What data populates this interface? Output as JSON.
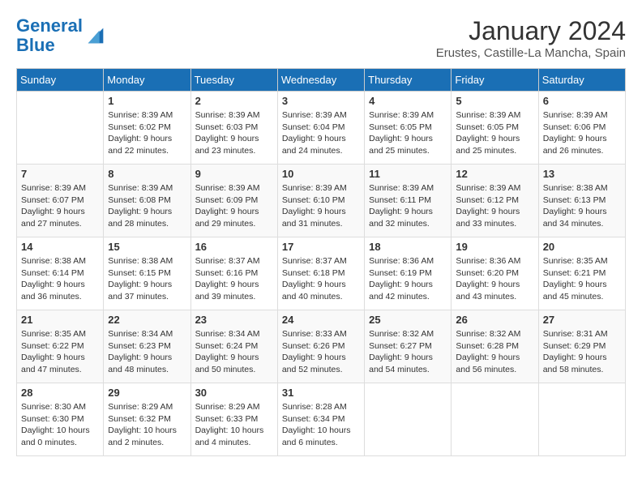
{
  "header": {
    "logo_line1": "General",
    "logo_line2": "Blue",
    "month": "January 2024",
    "location": "Erustes, Castille-La Mancha, Spain"
  },
  "days_of_week": [
    "Sunday",
    "Monday",
    "Tuesday",
    "Wednesday",
    "Thursday",
    "Friday",
    "Saturday"
  ],
  "weeks": [
    [
      {
        "day": "",
        "sunrise": "",
        "sunset": "",
        "daylight": ""
      },
      {
        "day": "1",
        "sunrise": "Sunrise: 8:39 AM",
        "sunset": "Sunset: 6:02 PM",
        "daylight": "Daylight: 9 hours and 22 minutes."
      },
      {
        "day": "2",
        "sunrise": "Sunrise: 8:39 AM",
        "sunset": "Sunset: 6:03 PM",
        "daylight": "Daylight: 9 hours and 23 minutes."
      },
      {
        "day": "3",
        "sunrise": "Sunrise: 8:39 AM",
        "sunset": "Sunset: 6:04 PM",
        "daylight": "Daylight: 9 hours and 24 minutes."
      },
      {
        "day": "4",
        "sunrise": "Sunrise: 8:39 AM",
        "sunset": "Sunset: 6:05 PM",
        "daylight": "Daylight: 9 hours and 25 minutes."
      },
      {
        "day": "5",
        "sunrise": "Sunrise: 8:39 AM",
        "sunset": "Sunset: 6:05 PM",
        "daylight": "Daylight: 9 hours and 25 minutes."
      },
      {
        "day": "6",
        "sunrise": "Sunrise: 8:39 AM",
        "sunset": "Sunset: 6:06 PM",
        "daylight": "Daylight: 9 hours and 26 minutes."
      }
    ],
    [
      {
        "day": "7",
        "sunrise": "Sunrise: 8:39 AM",
        "sunset": "Sunset: 6:07 PM",
        "daylight": "Daylight: 9 hours and 27 minutes."
      },
      {
        "day": "8",
        "sunrise": "Sunrise: 8:39 AM",
        "sunset": "Sunset: 6:08 PM",
        "daylight": "Daylight: 9 hours and 28 minutes."
      },
      {
        "day": "9",
        "sunrise": "Sunrise: 8:39 AM",
        "sunset": "Sunset: 6:09 PM",
        "daylight": "Daylight: 9 hours and 29 minutes."
      },
      {
        "day": "10",
        "sunrise": "Sunrise: 8:39 AM",
        "sunset": "Sunset: 6:10 PM",
        "daylight": "Daylight: 9 hours and 31 minutes."
      },
      {
        "day": "11",
        "sunrise": "Sunrise: 8:39 AM",
        "sunset": "Sunset: 6:11 PM",
        "daylight": "Daylight: 9 hours and 32 minutes."
      },
      {
        "day": "12",
        "sunrise": "Sunrise: 8:39 AM",
        "sunset": "Sunset: 6:12 PM",
        "daylight": "Daylight: 9 hours and 33 minutes."
      },
      {
        "day": "13",
        "sunrise": "Sunrise: 8:38 AM",
        "sunset": "Sunset: 6:13 PM",
        "daylight": "Daylight: 9 hours and 34 minutes."
      }
    ],
    [
      {
        "day": "14",
        "sunrise": "Sunrise: 8:38 AM",
        "sunset": "Sunset: 6:14 PM",
        "daylight": "Daylight: 9 hours and 36 minutes."
      },
      {
        "day": "15",
        "sunrise": "Sunrise: 8:38 AM",
        "sunset": "Sunset: 6:15 PM",
        "daylight": "Daylight: 9 hours and 37 minutes."
      },
      {
        "day": "16",
        "sunrise": "Sunrise: 8:37 AM",
        "sunset": "Sunset: 6:16 PM",
        "daylight": "Daylight: 9 hours and 39 minutes."
      },
      {
        "day": "17",
        "sunrise": "Sunrise: 8:37 AM",
        "sunset": "Sunset: 6:18 PM",
        "daylight": "Daylight: 9 hours and 40 minutes."
      },
      {
        "day": "18",
        "sunrise": "Sunrise: 8:36 AM",
        "sunset": "Sunset: 6:19 PM",
        "daylight": "Daylight: 9 hours and 42 minutes."
      },
      {
        "day": "19",
        "sunrise": "Sunrise: 8:36 AM",
        "sunset": "Sunset: 6:20 PM",
        "daylight": "Daylight: 9 hours and 43 minutes."
      },
      {
        "day": "20",
        "sunrise": "Sunrise: 8:35 AM",
        "sunset": "Sunset: 6:21 PM",
        "daylight": "Daylight: 9 hours and 45 minutes."
      }
    ],
    [
      {
        "day": "21",
        "sunrise": "Sunrise: 8:35 AM",
        "sunset": "Sunset: 6:22 PM",
        "daylight": "Daylight: 9 hours and 47 minutes."
      },
      {
        "day": "22",
        "sunrise": "Sunrise: 8:34 AM",
        "sunset": "Sunset: 6:23 PM",
        "daylight": "Daylight: 9 hours and 48 minutes."
      },
      {
        "day": "23",
        "sunrise": "Sunrise: 8:34 AM",
        "sunset": "Sunset: 6:24 PM",
        "daylight": "Daylight: 9 hours and 50 minutes."
      },
      {
        "day": "24",
        "sunrise": "Sunrise: 8:33 AM",
        "sunset": "Sunset: 6:26 PM",
        "daylight": "Daylight: 9 hours and 52 minutes."
      },
      {
        "day": "25",
        "sunrise": "Sunrise: 8:32 AM",
        "sunset": "Sunset: 6:27 PM",
        "daylight": "Daylight: 9 hours and 54 minutes."
      },
      {
        "day": "26",
        "sunrise": "Sunrise: 8:32 AM",
        "sunset": "Sunset: 6:28 PM",
        "daylight": "Daylight: 9 hours and 56 minutes."
      },
      {
        "day": "27",
        "sunrise": "Sunrise: 8:31 AM",
        "sunset": "Sunset: 6:29 PM",
        "daylight": "Daylight: 9 hours and 58 minutes."
      }
    ],
    [
      {
        "day": "28",
        "sunrise": "Sunrise: 8:30 AM",
        "sunset": "Sunset: 6:30 PM",
        "daylight": "Daylight: 10 hours and 0 minutes."
      },
      {
        "day": "29",
        "sunrise": "Sunrise: 8:29 AM",
        "sunset": "Sunset: 6:32 PM",
        "daylight": "Daylight: 10 hours and 2 minutes."
      },
      {
        "day": "30",
        "sunrise": "Sunrise: 8:29 AM",
        "sunset": "Sunset: 6:33 PM",
        "daylight": "Daylight: 10 hours and 4 minutes."
      },
      {
        "day": "31",
        "sunrise": "Sunrise: 8:28 AM",
        "sunset": "Sunset: 6:34 PM",
        "daylight": "Daylight: 10 hours and 6 minutes."
      },
      {
        "day": "",
        "sunrise": "",
        "sunset": "",
        "daylight": ""
      },
      {
        "day": "",
        "sunrise": "",
        "sunset": "",
        "daylight": ""
      },
      {
        "day": "",
        "sunrise": "",
        "sunset": "",
        "daylight": ""
      }
    ]
  ]
}
